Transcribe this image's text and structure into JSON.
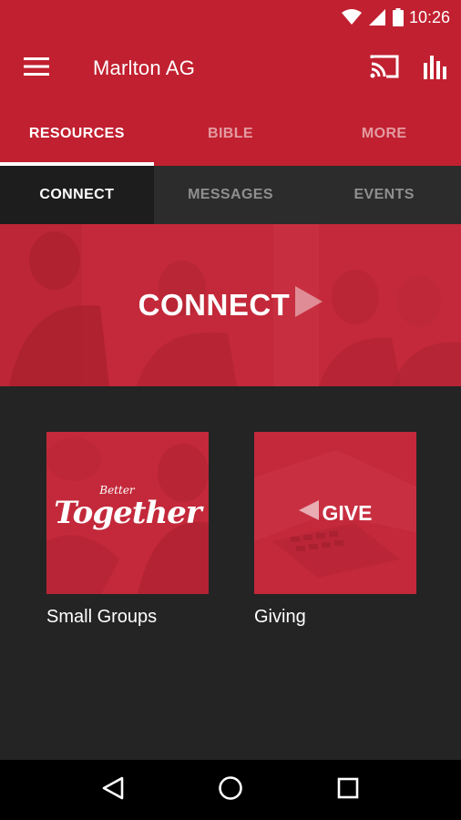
{
  "status_bar": {
    "time": "10:26",
    "icons": [
      "wifi-icon",
      "signal-icon",
      "battery-icon"
    ]
  },
  "toolbar": {
    "title": "Marlton AG",
    "icons": [
      "menu-icon",
      "cast-icon",
      "bar-chart-icon"
    ]
  },
  "main_tabs": [
    {
      "label": "RESOURCES",
      "active": true
    },
    {
      "label": "BIBLE",
      "active": false
    },
    {
      "label": "MORE",
      "active": false
    }
  ],
  "sub_tabs": [
    {
      "label": "CONNECT",
      "active": true
    },
    {
      "label": "MESSAGES",
      "active": false
    },
    {
      "label": "EVENTS",
      "active": false
    }
  ],
  "banner": {
    "text": "CONNECT"
  },
  "tiles": [
    {
      "label": "Small Groups",
      "image_text_small": "Better",
      "image_text_big": "Together"
    },
    {
      "label": "Giving",
      "image_text": "GIVE"
    }
  ],
  "nav_bar": {
    "icons": [
      "back-icon",
      "home-icon",
      "recents-icon"
    ]
  },
  "colors": {
    "brand": "#c12030",
    "tile": "#c3293a",
    "background": "#242424",
    "sub_tab_bar": "#2c2c2c"
  }
}
